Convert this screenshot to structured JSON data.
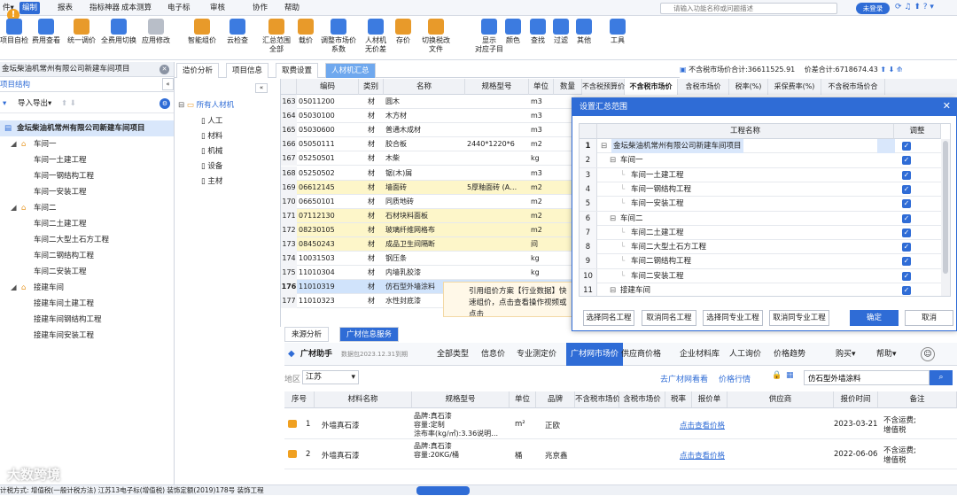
{
  "menu": [
    "件▾",
    "编制",
    "报表",
    "指标神器",
    "成本测算",
    "电子标",
    "审核",
    "协作",
    "帮助"
  ],
  "menu_active_index": 1,
  "search": {
    "placeholder": "请输入功能名称或问题描述"
  },
  "login_label": "未登录",
  "ribbon": [
    {
      "label": "项目自检",
      "color": "#3c7be0"
    },
    {
      "label": "费用查看",
      "color": "#3c7be0"
    },
    {
      "label": "统一调价",
      "color": "#e89a2a"
    },
    {
      "label": "全费用切换",
      "color": "#3c7be0"
    },
    {
      "label": "应用修改",
      "color": "#b8bec8"
    },
    {
      "label": "智能组价",
      "color": "#e89a2a"
    },
    {
      "label": "云检查",
      "color": "#3c7be0"
    },
    {
      "label": "汇总范围",
      "sub": "全部",
      "color": "#e89a2a"
    },
    {
      "label": "载价",
      "color": "#e89a2a"
    },
    {
      "label": "调整市场价",
      "sub": "系数",
      "color": "#3c7be0"
    },
    {
      "label": "人材机",
      "sub": "无价差",
      "color": "#3c7be0"
    },
    {
      "label": "存价",
      "color": "#e89a2a"
    },
    {
      "label": "切换税改",
      "sub": "文件",
      "color": "#e89a2a"
    },
    {
      "label": "显示",
      "sub": "对应子目",
      "color": "#3c7be0"
    },
    {
      "label": "颜色",
      "color": "#3c7be0"
    },
    {
      "label": "查找",
      "color": "#3c7be0"
    },
    {
      "label": "过滤",
      "color": "#3c7be0"
    },
    {
      "label": "其他",
      "color": "#3c7be0"
    },
    {
      "label": "工具",
      "color": "#3c7be0"
    }
  ],
  "project": {
    "header": "金坛柴油机常州有限公司新建车间项目",
    "tab": "项目结构",
    "tool_import": "导入导出▾"
  },
  "tree": [
    {
      "label": "金坛柴油机常州有限公司新建车间项目",
      "level": 0,
      "sel": true
    },
    {
      "label": "车间一",
      "level": 1
    },
    {
      "label": "车间一土建工程",
      "level": 2
    },
    {
      "label": "车间一钢结构工程",
      "level": 2
    },
    {
      "label": "车间一安装工程",
      "level": 2
    },
    {
      "label": "车间二",
      "level": 1
    },
    {
      "label": "车间二土建工程",
      "level": 2
    },
    {
      "label": "车间二大型土石方工程",
      "level": 2
    },
    {
      "label": "车间二钢结构工程",
      "level": 2
    },
    {
      "label": "车间二安装工程",
      "level": 2
    },
    {
      "label": "接建车间",
      "level": 1
    },
    {
      "label": "接建车间土建工程",
      "level": 2
    },
    {
      "label": "接建车间钢结构工程",
      "level": 2
    },
    {
      "label": "接建车间安装工程",
      "level": 2
    }
  ],
  "tabs": [
    "造价分析",
    "项目信息",
    "取费设置",
    "人材机汇总"
  ],
  "resources": {
    "root": "所有人材机",
    "items": [
      "人工",
      "材料",
      "机械",
      "设备",
      "主材"
    ]
  },
  "table": {
    "headers": [
      "",
      "编码",
      "类别",
      "名称",
      "规格型号",
      "单位",
      "数量"
    ],
    "rows": [
      {
        "n": "163",
        "code": "05011200",
        "cat": "材",
        "name": "圆木",
        "spec": "",
        "unit": "m3"
      },
      {
        "n": "164",
        "code": "05030100",
        "cat": "材",
        "name": "木方材",
        "spec": "",
        "unit": "m3"
      },
      {
        "n": "165",
        "code": "05030600",
        "cat": "材",
        "name": "普通木成材",
        "spec": "",
        "unit": "m3"
      },
      {
        "n": "166",
        "code": "05050111",
        "cat": "材",
        "name": "胶合板",
        "spec": "2440*1220*6",
        "unit": "m2"
      },
      {
        "n": "167",
        "code": "05250501",
        "cat": "材",
        "name": "木柴",
        "spec": "",
        "unit": "kg"
      },
      {
        "n": "168",
        "code": "05250502",
        "cat": "材",
        "name": "锯(木)屑",
        "spec": "",
        "unit": "m3"
      },
      {
        "n": "169",
        "code": "06612145",
        "cat": "材",
        "name": "墙面砖",
        "spec": "5厚釉面砖 (A…",
        "unit": "m2",
        "hl": true
      },
      {
        "n": "170",
        "code": "06650101",
        "cat": "材",
        "name": "同质地砖",
        "spec": "",
        "unit": "m2"
      },
      {
        "n": "171",
        "code": "07112130",
        "cat": "材",
        "name": "石材块料面板",
        "spec": "",
        "unit": "m2",
        "hl": true
      },
      {
        "n": "172",
        "code": "08230105",
        "cat": "材",
        "name": "玻璃纤维网格布",
        "spec": "",
        "unit": "m2",
        "hl": true
      },
      {
        "n": "173",
        "code": "08450243",
        "cat": "材",
        "name": "成品卫生间隔断",
        "spec": "",
        "unit": "间",
        "hl": true
      },
      {
        "n": "174",
        "code": "10031503",
        "cat": "材",
        "name": "钢压条",
        "spec": "",
        "unit": "kg"
      },
      {
        "n": "175",
        "code": "11010304",
        "cat": "材",
        "name": "内墙乳胶漆",
        "spec": "",
        "unit": "kg"
      },
      {
        "n": "176",
        "code": "11010319",
        "cat": "材",
        "name": "仿石型外墙涂料",
        "spec": "",
        "unit": "",
        "sel": true
      },
      {
        "n": "177",
        "code": "11010323",
        "cat": "材",
        "name": "水性封底漆",
        "spec": "",
        "unit": ""
      }
    ]
  },
  "summary": {
    "market_total": "不含税市场价合计:36611525.91",
    "diff_total": "价差合计:6718674.43"
  },
  "right_headers": [
    "不含税预算价",
    "不含税市场价",
    "含税市场价",
    "税率(%)",
    "采保费率(%)",
    "不含税市场价合"
  ],
  "dialog": {
    "title": "设置汇总范围",
    "col_name": "工程名称",
    "col_adjust": "调整",
    "rows": [
      {
        "n": "1",
        "label": "金坛柴油机常州有限公司新建车间项目",
        "level": 0,
        "sel": true
      },
      {
        "n": "2",
        "label": "车间一",
        "level": 1
      },
      {
        "n": "3",
        "label": "车间一土建工程",
        "level": 2
      },
      {
        "n": "4",
        "label": "车间一钢结构工程",
        "level": 2
      },
      {
        "n": "5",
        "label": "车间一安装工程",
        "level": 2
      },
      {
        "n": "6",
        "label": "车间二",
        "level": 1
      },
      {
        "n": "7",
        "label": "车间二土建工程",
        "level": 2
      },
      {
        "n": "8",
        "label": "车间二大型土石方工程",
        "level": 2
      },
      {
        "n": "9",
        "label": "车间二钢结构工程",
        "level": 2
      },
      {
        "n": "10",
        "label": "车间二安装工程",
        "level": 2
      },
      {
        "n": "11",
        "label": "接建车间",
        "level": 1
      }
    ],
    "buttons": [
      "选择同名工程",
      "取消同名工程",
      "选择同专业工程",
      "取消同专业工程"
    ],
    "ok": "确定",
    "cancel": "取消"
  },
  "tooltip": "引用组价方案【行业数据】快速组价，点击查看操作视频或点击",
  "bottom_tabs": [
    "来源分析",
    "广材信息服务"
  ],
  "bnav": {
    "brand": "广材助手",
    "date": "数据包2023.12.31到期",
    "items": [
      "全部类型",
      "信息价",
      "专业测定价",
      "广材网市场价",
      "供应商价格",
      "企业材料库",
      "人工询价",
      "价格趋势"
    ],
    "active": 3,
    "buy": "购买▾",
    "help": "帮助▾"
  },
  "bfilter": {
    "region_label": "地区",
    "region": "江苏",
    "link1": "去广材网看看",
    "link2": "价格行情",
    "query": "仿石型外墙涂料"
  },
  "bheaders": [
    "序号",
    "材料名称",
    "规格型号",
    "单位",
    "品牌",
    "不含税市场价",
    "含税市场价",
    "税率",
    "报价单",
    "供应商",
    "报价时间",
    "备注"
  ],
  "brows": [
    {
      "n": "1",
      "name": "外墙真石漆",
      "spec": [
        "品牌:真石漆",
        "容量:定制",
        "涂布率(kg/㎡):3.36说明…"
      ],
      "unit": "m²",
      "brand": "正欧",
      "link": "点击查看价格",
      "time": "2023-03-21",
      "note": [
        "不含运费;",
        "增值税"
      ]
    },
    {
      "n": "2",
      "name": "外墙真石漆",
      "spec": [
        "品牌:真石漆",
        "容量:20KG/桶"
      ],
      "unit": "桶",
      "brand": "兆京鑫",
      "link": "点击查看价格",
      "time": "2022-06-06",
      "note": [
        "不含运费;",
        "增值税"
      ]
    }
  ],
  "status": "计税方式: 增值税(一般计税方法)      江苏13电子标(增值税)      装饰定额(2019)178号      装饰工程",
  "watermark": "大数跨境"
}
